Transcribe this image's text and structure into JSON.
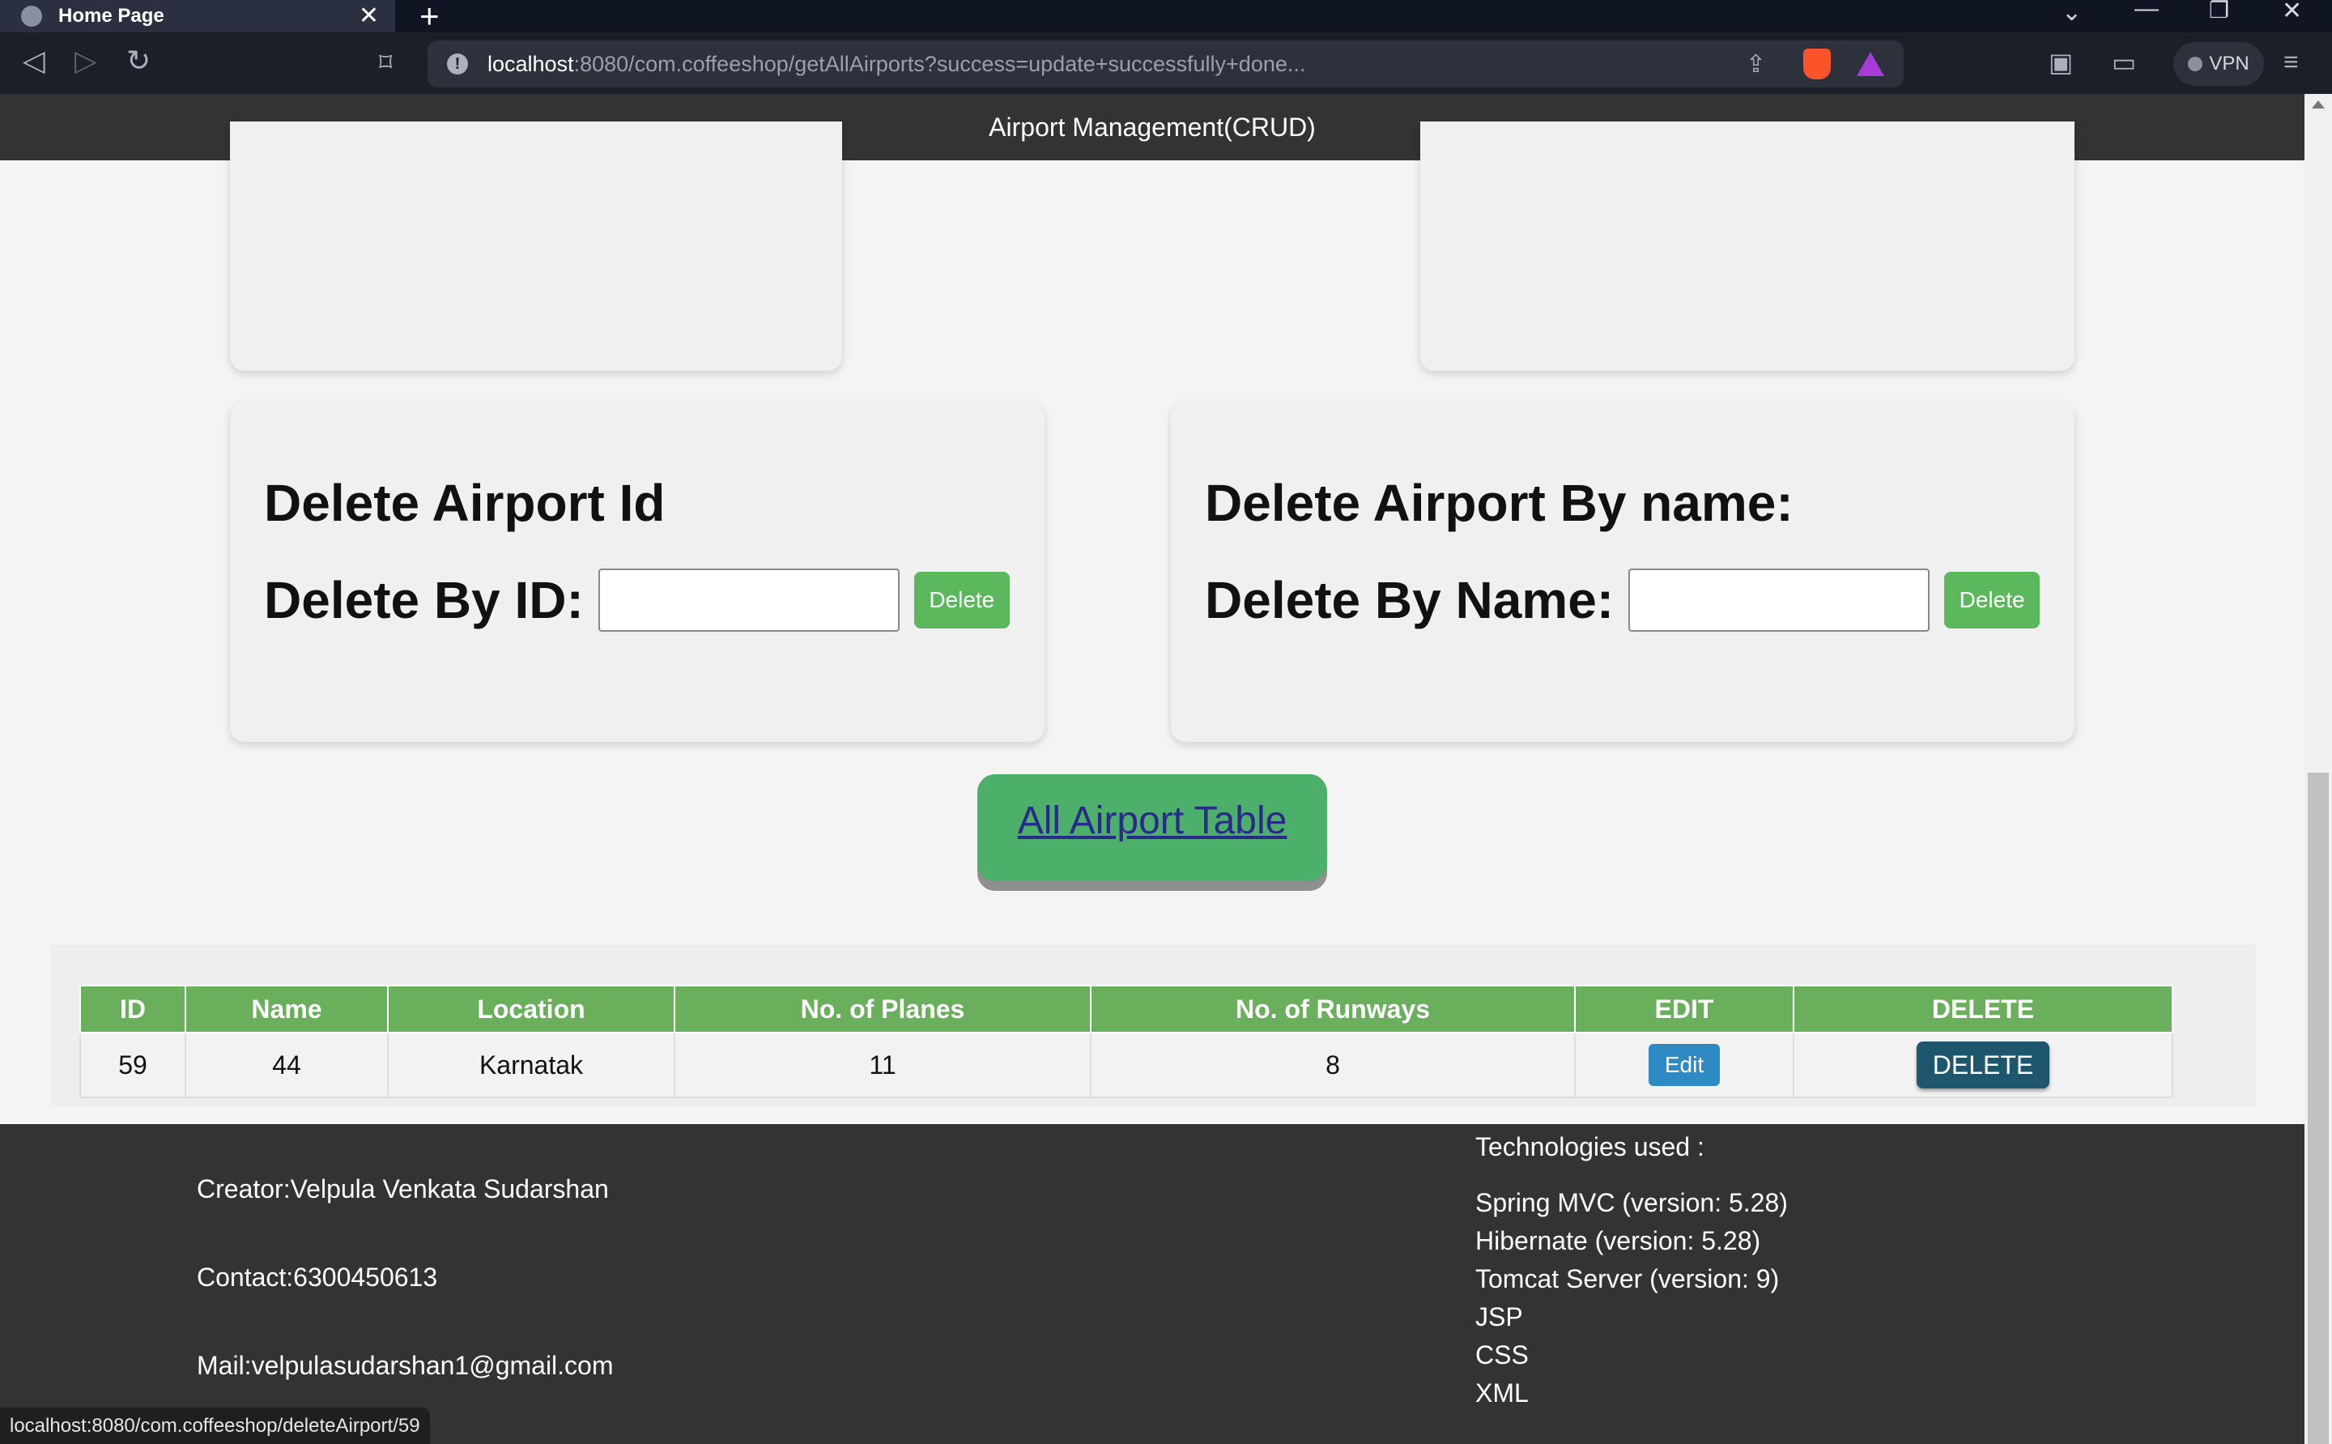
{
  "browser": {
    "tab_title": "Home Page",
    "url_host": "localhost",
    "url_rest": ":8080/com.coffeeshop/getAllAirports?success=update+successfully+done...",
    "vpn_label": "VPN",
    "status_url": "localhost:8080/com.coffeeshop/deleteAirport/59"
  },
  "header": {
    "title": "Airport Management(CRUD)"
  },
  "delete_id": {
    "heading": "Delete Airport Id",
    "label": "Delete By ID:",
    "button": "Delete"
  },
  "delete_name": {
    "heading": "Delete Airport By name:",
    "label": "Delete By Name:",
    "button": "Delete"
  },
  "all_table_link": "All Airport Table",
  "table": {
    "headers": [
      "ID",
      "Name",
      "Location",
      "No. of Planes",
      "No. of Runways",
      "EDIT",
      "DELETE"
    ],
    "rows": [
      {
        "id": "59",
        "name": "44",
        "location": "Karnatak",
        "planes": "11",
        "runways": "8",
        "edit": "Edit",
        "delete": "DELETE"
      }
    ]
  },
  "footer": {
    "creator": "Creator:Velpula Venkata Sudarshan",
    "contact": "Contact:6300450613",
    "mail": "Mail:velpulasudarshan1@gmail.com",
    "tech_title": "Technologies used :",
    "tech": [
      "Spring MVC (version: 5.28)",
      "Hibernate (version: 5.28)",
      "Tomcat Server (version: 9)",
      "JSP",
      "CSS",
      "XML"
    ]
  }
}
